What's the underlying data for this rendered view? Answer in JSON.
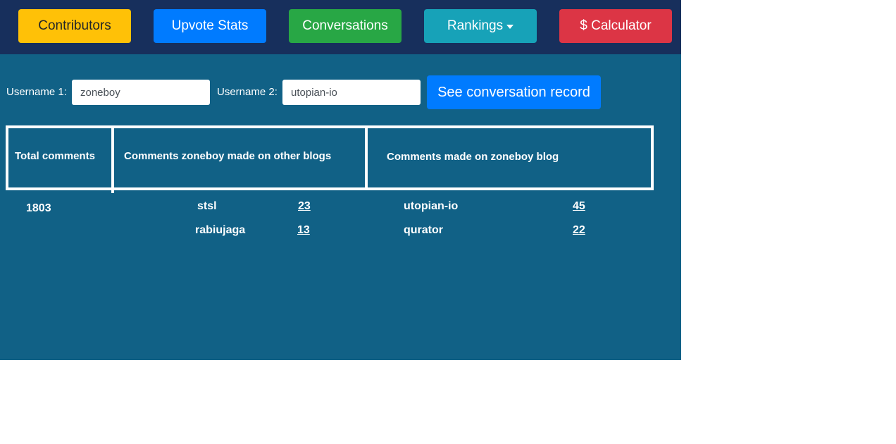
{
  "nav": {
    "buttons": [
      {
        "label": "Contributors",
        "color": "#ffc107",
        "text_color": "#212529"
      },
      {
        "label": "Upvote Stats",
        "color": "#007bff",
        "text_color": "#ffffff"
      },
      {
        "label": "Conversations",
        "color": "#28a745",
        "text_color": "#ffffff"
      },
      {
        "label": "Rankings",
        "color": "#17a2b8",
        "text_color": "#ffffff",
        "dropdown": true
      },
      {
        "label": "$ Calculator",
        "color": "#dc3545",
        "text_color": "#ffffff"
      }
    ]
  },
  "form": {
    "username1_label": "Username 1:",
    "username1_value": "zoneboy",
    "username2_label": "Username 2:",
    "username2_value": "utopian-io",
    "submit_label": "See conversation record"
  },
  "table": {
    "headers": [
      "Total comments",
      "Comments zoneboy made on other blogs",
      "Comments made on zoneboy blog"
    ],
    "total": "1803",
    "made_on_other": [
      {
        "user": "stsl",
        "count": "23"
      },
      {
        "user": "rabiujaga",
        "count": "13"
      }
    ],
    "made_on_own": [
      {
        "user": "utopian-io",
        "count": "45"
      },
      {
        "user": "qurator",
        "count": "22"
      }
    ]
  }
}
